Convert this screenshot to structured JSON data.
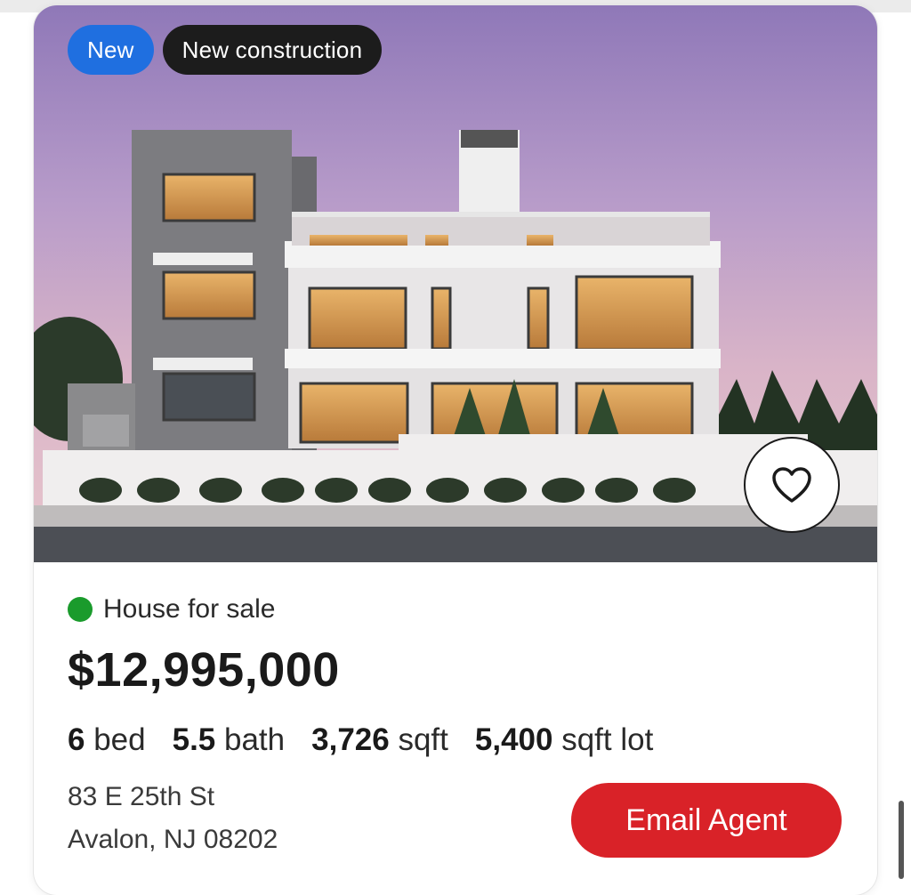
{
  "listing": {
    "badges": {
      "new": "New",
      "construction": "New construction"
    },
    "status": "House for sale",
    "status_color": "#1a9b2c",
    "price": "$12,995,000",
    "specs": {
      "beds_value": "6",
      "beds_unit": "bed",
      "baths_value": "5.5",
      "baths_unit": "bath",
      "sqft_value": "3,726",
      "sqft_unit": "sqft",
      "lot_value": "5,400",
      "lot_unit": "sqft lot"
    },
    "address": {
      "line1": "83 E 25th St",
      "line2": "Avalon, NJ 08202"
    },
    "email_button": "Email Agent",
    "favorite_icon": "heart-outline-icon"
  },
  "colors": {
    "accent_red": "#d92228",
    "badge_blue": "#1f6fe0",
    "badge_dark": "#1c1c1c"
  }
}
